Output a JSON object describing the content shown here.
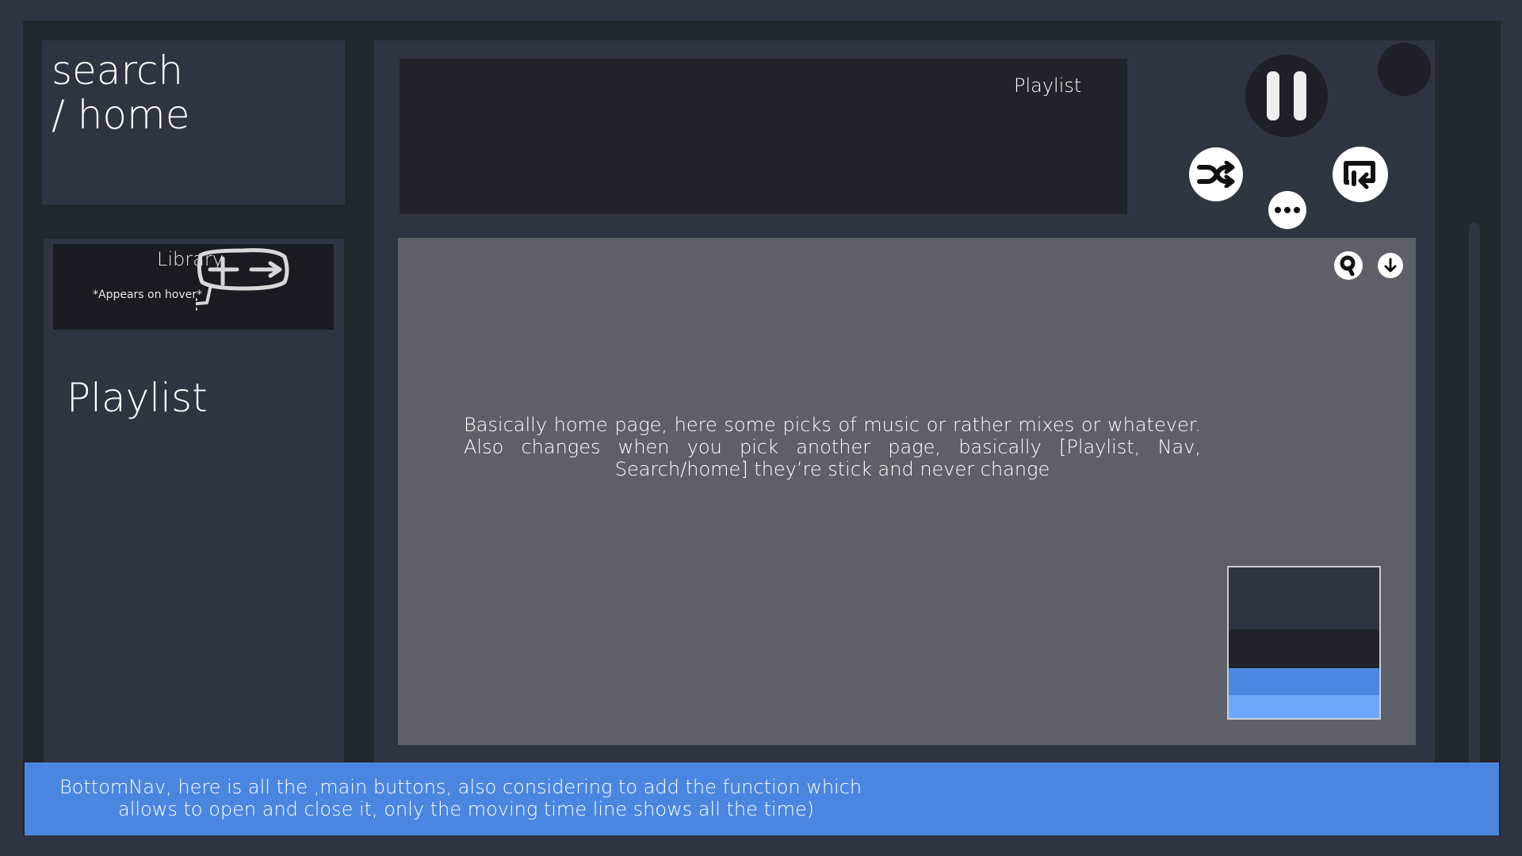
{
  "search_panel": {
    "title_line1": "search",
    "title_line2": "/ home"
  },
  "library": {
    "label": "Library",
    "hover_note": "*Appears on hover*",
    "playlist_label": "Playlist"
  },
  "now_playing": {
    "label": "Playlist"
  },
  "controls": {
    "pause_icon": "pause-icon",
    "shuffle_icon": "shuffle-icon",
    "more_icon": "more-icon",
    "repeat_icon": "repeat-icon"
  },
  "content": {
    "description": "Basically home page, here some picks of music or rather mixes or whatever. Also changes when you pick another page, basically [Playlist, Nav, Search/home] they’re stick and never change",
    "icons": [
      "search-icon",
      "download-icon"
    ]
  },
  "palette": {
    "colors": [
      "#2f3540",
      "#202329",
      "#4a86e0",
      "#6fa8fa"
    ]
  },
  "bottom_nav": {
    "line1": "BottomNav, here is all the ,main buttons, also considering to add the function which",
    "line2": "allows to open and close it, only the moving time line shows all the time)"
  }
}
